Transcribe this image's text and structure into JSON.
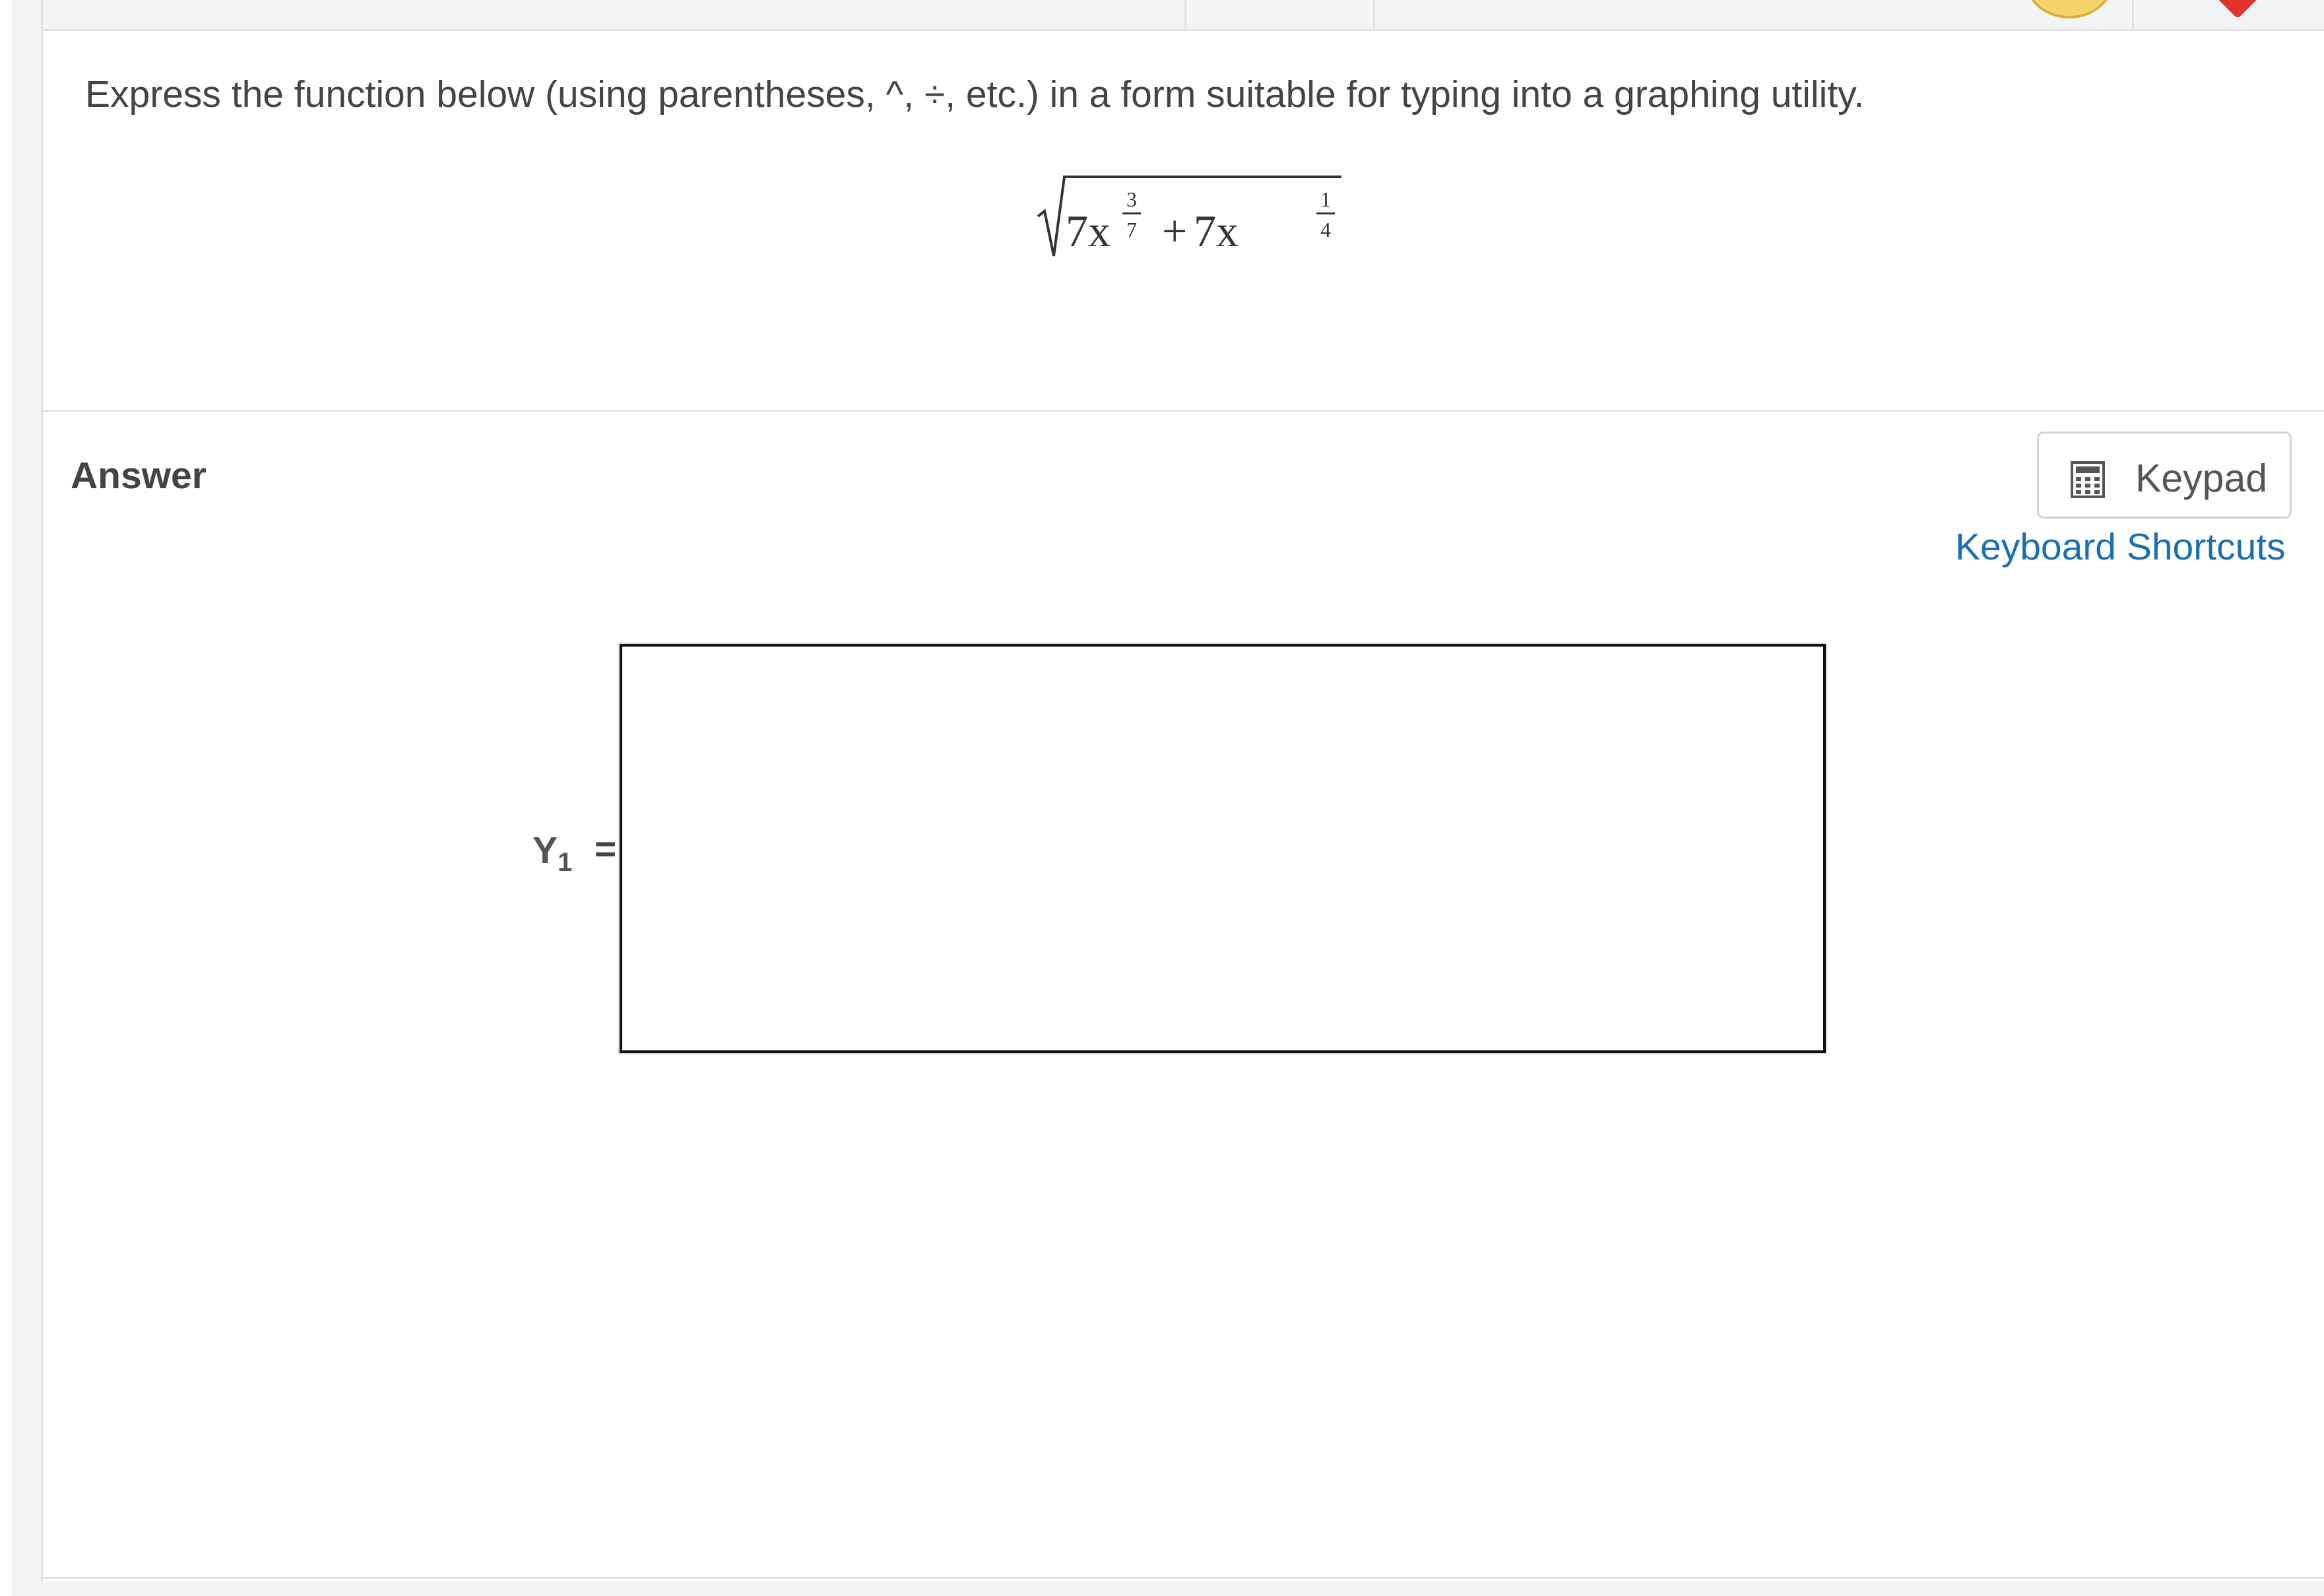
{
  "question": {
    "prompt": "Express the function below (using parentheses, ^, ÷, etc.) in a form suitable for typing into a graphing utility.",
    "formula": {
      "term1_base": "7x",
      "term1_exp_num": "3",
      "term1_exp_den": "7",
      "operator": "+",
      "term2_base": "7x",
      "term2_exp_num": "1",
      "term2_exp_den": "4"
    }
  },
  "answer": {
    "heading": "Answer",
    "keypad_label": "Keypad",
    "keyboard_shortcuts_label": "Keyboard Shortcuts",
    "variable": "Y",
    "variable_subscript": "1",
    "equals": "=",
    "input_value": ""
  },
  "icons": {
    "keypad": "calculator-icon",
    "flag": "flag-icon",
    "coin": "coin-icon"
  },
  "colors": {
    "link": "#1b6fae",
    "text": "#444444",
    "flag": "#e0312b",
    "coin": "#f6d36a"
  }
}
